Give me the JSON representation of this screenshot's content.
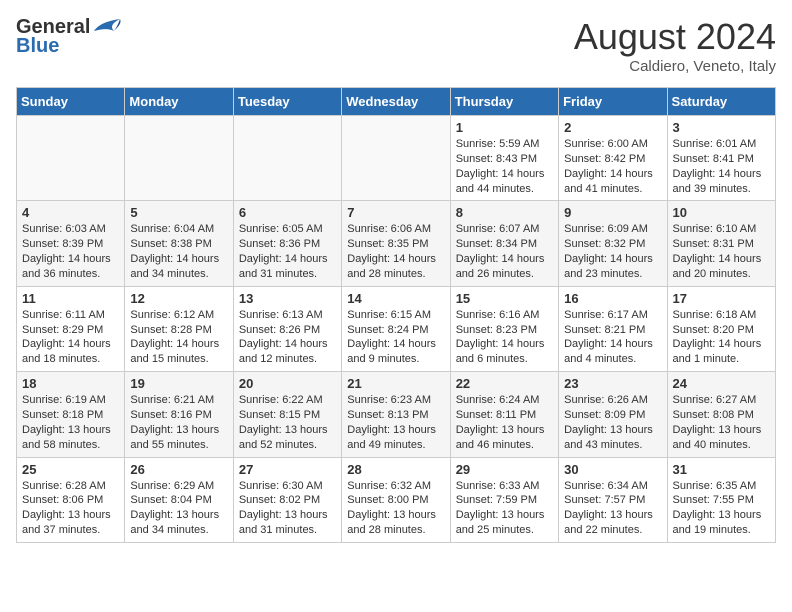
{
  "header": {
    "logo_general": "General",
    "logo_blue": "Blue",
    "title": "August 2024",
    "location": "Caldiero, Veneto, Italy"
  },
  "days_of_week": [
    "Sunday",
    "Monday",
    "Tuesday",
    "Wednesday",
    "Thursday",
    "Friday",
    "Saturday"
  ],
  "weeks": [
    [
      {
        "day": "",
        "content": ""
      },
      {
        "day": "",
        "content": ""
      },
      {
        "day": "",
        "content": ""
      },
      {
        "day": "",
        "content": ""
      },
      {
        "day": "1",
        "content": "Sunrise: 5:59 AM\nSunset: 8:43 PM\nDaylight: 14 hours and 44 minutes."
      },
      {
        "day": "2",
        "content": "Sunrise: 6:00 AM\nSunset: 8:42 PM\nDaylight: 14 hours and 41 minutes."
      },
      {
        "day": "3",
        "content": "Sunrise: 6:01 AM\nSunset: 8:41 PM\nDaylight: 14 hours and 39 minutes."
      }
    ],
    [
      {
        "day": "4",
        "content": "Sunrise: 6:03 AM\nSunset: 8:39 PM\nDaylight: 14 hours and 36 minutes."
      },
      {
        "day": "5",
        "content": "Sunrise: 6:04 AM\nSunset: 8:38 PM\nDaylight: 14 hours and 34 minutes."
      },
      {
        "day": "6",
        "content": "Sunrise: 6:05 AM\nSunset: 8:36 PM\nDaylight: 14 hours and 31 minutes."
      },
      {
        "day": "7",
        "content": "Sunrise: 6:06 AM\nSunset: 8:35 PM\nDaylight: 14 hours and 28 minutes."
      },
      {
        "day": "8",
        "content": "Sunrise: 6:07 AM\nSunset: 8:34 PM\nDaylight: 14 hours and 26 minutes."
      },
      {
        "day": "9",
        "content": "Sunrise: 6:09 AM\nSunset: 8:32 PM\nDaylight: 14 hours and 23 minutes."
      },
      {
        "day": "10",
        "content": "Sunrise: 6:10 AM\nSunset: 8:31 PM\nDaylight: 14 hours and 20 minutes."
      }
    ],
    [
      {
        "day": "11",
        "content": "Sunrise: 6:11 AM\nSunset: 8:29 PM\nDaylight: 14 hours and 18 minutes."
      },
      {
        "day": "12",
        "content": "Sunrise: 6:12 AM\nSunset: 8:28 PM\nDaylight: 14 hours and 15 minutes."
      },
      {
        "day": "13",
        "content": "Sunrise: 6:13 AM\nSunset: 8:26 PM\nDaylight: 14 hours and 12 minutes."
      },
      {
        "day": "14",
        "content": "Sunrise: 6:15 AM\nSunset: 8:24 PM\nDaylight: 14 hours and 9 minutes."
      },
      {
        "day": "15",
        "content": "Sunrise: 6:16 AM\nSunset: 8:23 PM\nDaylight: 14 hours and 6 minutes."
      },
      {
        "day": "16",
        "content": "Sunrise: 6:17 AM\nSunset: 8:21 PM\nDaylight: 14 hours and 4 minutes."
      },
      {
        "day": "17",
        "content": "Sunrise: 6:18 AM\nSunset: 8:20 PM\nDaylight: 14 hours and 1 minute."
      }
    ],
    [
      {
        "day": "18",
        "content": "Sunrise: 6:19 AM\nSunset: 8:18 PM\nDaylight: 13 hours and 58 minutes."
      },
      {
        "day": "19",
        "content": "Sunrise: 6:21 AM\nSunset: 8:16 PM\nDaylight: 13 hours and 55 minutes."
      },
      {
        "day": "20",
        "content": "Sunrise: 6:22 AM\nSunset: 8:15 PM\nDaylight: 13 hours and 52 minutes."
      },
      {
        "day": "21",
        "content": "Sunrise: 6:23 AM\nSunset: 8:13 PM\nDaylight: 13 hours and 49 minutes."
      },
      {
        "day": "22",
        "content": "Sunrise: 6:24 AM\nSunset: 8:11 PM\nDaylight: 13 hours and 46 minutes."
      },
      {
        "day": "23",
        "content": "Sunrise: 6:26 AM\nSunset: 8:09 PM\nDaylight: 13 hours and 43 minutes."
      },
      {
        "day": "24",
        "content": "Sunrise: 6:27 AM\nSunset: 8:08 PM\nDaylight: 13 hours and 40 minutes."
      }
    ],
    [
      {
        "day": "25",
        "content": "Sunrise: 6:28 AM\nSunset: 8:06 PM\nDaylight: 13 hours and 37 minutes."
      },
      {
        "day": "26",
        "content": "Sunrise: 6:29 AM\nSunset: 8:04 PM\nDaylight: 13 hours and 34 minutes."
      },
      {
        "day": "27",
        "content": "Sunrise: 6:30 AM\nSunset: 8:02 PM\nDaylight: 13 hours and 31 minutes."
      },
      {
        "day": "28",
        "content": "Sunrise: 6:32 AM\nSunset: 8:00 PM\nDaylight: 13 hours and 28 minutes."
      },
      {
        "day": "29",
        "content": "Sunrise: 6:33 AM\nSunset: 7:59 PM\nDaylight: 13 hours and 25 minutes."
      },
      {
        "day": "30",
        "content": "Sunrise: 6:34 AM\nSunset: 7:57 PM\nDaylight: 13 hours and 22 minutes."
      },
      {
        "day": "31",
        "content": "Sunrise: 6:35 AM\nSunset: 7:55 PM\nDaylight: 13 hours and 19 minutes."
      }
    ]
  ]
}
